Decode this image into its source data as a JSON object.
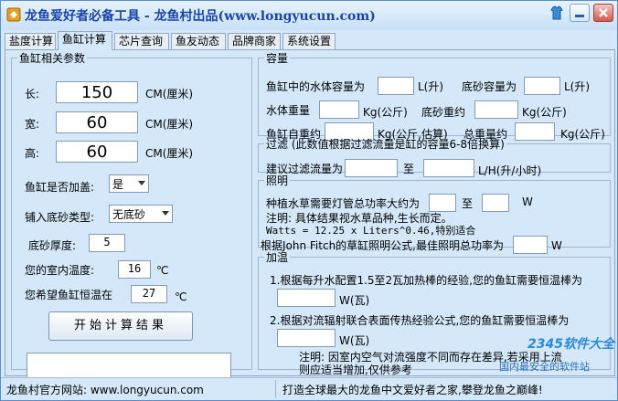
{
  "window": {
    "title": "龙鱼爱好者必备工具 - 龙鱼村出品(www.longyucun.com)"
  },
  "tabs": [
    "盐度计算",
    "鱼缸计算",
    "芯片查询",
    "鱼友动态",
    "品牌商家",
    "系统设置"
  ],
  "tank_params": {
    "legend": "鱼缸相关参数",
    "length_label": "长:",
    "length_value": "150",
    "width_label": "宽:",
    "width_value": "60",
    "height_label": "高:",
    "height_value": "60",
    "unit": "CM(厘米)",
    "cover_label": "鱼缸是否加盖:",
    "cover_value": "是",
    "substrate_label": "铺入底砂类型:",
    "substrate_value": "无底砂",
    "substrate_thickness_label": "底砂厚度:",
    "substrate_thickness_value": "5",
    "room_temp_label": "您的室内温度:",
    "room_temp_value": "16",
    "room_temp_unit": "℃",
    "target_temp_label": "您希望鱼缸恒温在",
    "target_temp_value": "27",
    "target_temp_unit": "℃",
    "calc_button": "开始计算结果",
    "result_text": ""
  },
  "capacity": {
    "legend": "容量",
    "water_volume_label": "鱼缸中的水体容量为",
    "water_volume_unit": "L(升)",
    "sand_volume_label": "底砂容量为",
    "sand_volume_unit": "L(升)",
    "water_weight_label": "水体重量",
    "water_weight_unit": "Kg(公斤)",
    "sand_weight_label": "底砂重约",
    "sand_weight_unit": "Kg(公斤)",
    "tank_weight_label": "鱼缸自重约",
    "tank_weight_unit": "Kg(公斤,估算)",
    "total_weight_label": "总重量约",
    "total_weight_unit": "Kg(公斤)"
  },
  "filter": {
    "legend": "过滤 (此数值根据过滤流量是缸的容量6-8倍换算)",
    "flow_label": "建议过滤流量为",
    "to_label": "至",
    "flow_unit": "L/H(升/小时)"
  },
  "lighting": {
    "legend": "照明",
    "plant_label": "种植水草需要灯管总功率大约为",
    "to_label": "至",
    "unit": "W",
    "note1": "注明: 具体结果视水草品种,生长而定。",
    "formula": "Watts = 12.25 x Liters^0.46,特别适合",
    "fitch_label": "根据John Fitch的草缸照明公式,最佳照明总功率为",
    "fitch_unit": "W"
  },
  "heating": {
    "legend": "加温",
    "method1_label": "1.根据每升水配置1.5至2瓦加热棒的经验,您的鱼缸需要恒温棒为",
    "method1_unit": "W(瓦)",
    "method2_label": "2.根据对流辐射联合表面传热经验公式,您的鱼缸需要恒温棒为",
    "method2_unit": "W(瓦)",
    "note_line1": "注明: 因室内空气对流强度不同而存在差异,若采用上流",
    "note_line2": "则应适当增加,仅供参考"
  },
  "statusbar": {
    "left": "龙鱼村官方网站: www.longyucun.com",
    "right": "打造全球最大的龙鱼中文爱好者之家,攀登龙鱼之巅峰!"
  },
  "watermark": {
    "brand": "2345软件大全",
    "sub": "国内最安全的软件站"
  },
  "colors": {
    "title": "#1a44a8",
    "panel_bg": "#d4e8fa",
    "border": "#5a8fcf"
  }
}
